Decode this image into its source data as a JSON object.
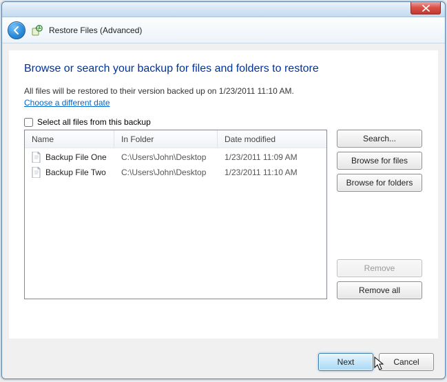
{
  "header": {
    "title": "Restore Files (Advanced)"
  },
  "main": {
    "heading": "Browse or search your backup for files and folders to restore",
    "info": "All files will be restored to their version backed up on 1/23/2011 11:10 AM.",
    "choose_date_link": "Choose a different date",
    "select_all_label": "Select all files from this backup"
  },
  "table": {
    "columns": {
      "name": "Name",
      "folder": "In Folder",
      "date": "Date modified"
    },
    "rows": [
      {
        "name": "Backup File One",
        "folder": "C:\\Users\\John\\Desktop",
        "date": "1/23/2011 11:09 AM"
      },
      {
        "name": "Backup File Two",
        "folder": "C:\\Users\\John\\Desktop",
        "date": "1/23/2011 11:10 AM"
      }
    ]
  },
  "buttons": {
    "search": "Search...",
    "browse_files": "Browse for files",
    "browse_folders": "Browse for folders",
    "remove": "Remove",
    "remove_all": "Remove all",
    "next": "Next",
    "cancel": "Cancel"
  }
}
